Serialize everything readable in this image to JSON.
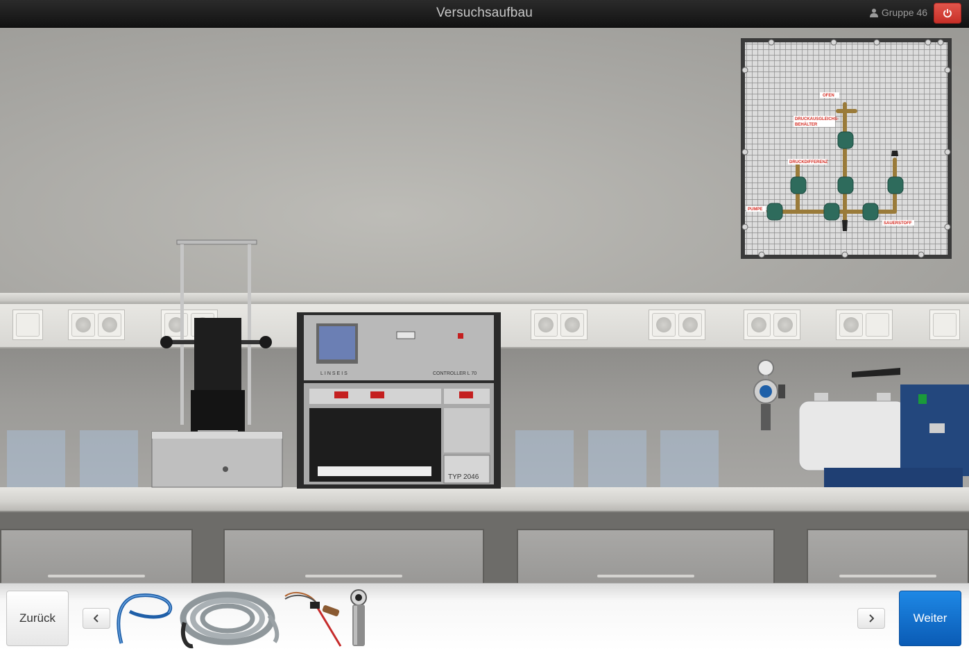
{
  "header": {
    "title": "Versuchsaufbau",
    "user_label": "Gruppe 46",
    "user_icon": "user-icon",
    "power_icon": "power-icon",
    "power_color": "#d9433a"
  },
  "panel": {
    "labels": {
      "ofen": "OFEN",
      "druckausgleich_1": "DRUCKAUSGLEICHS-",
      "druckausgleich_2": "BEHÄLTER",
      "druckdifferenz": "DRUCKDIFFERENZ",
      "pumpe": "PUMPE",
      "sauerstoff": "SAUERSTOFF"
    }
  },
  "devices": {
    "controller_name": "CONTROLLER L 70",
    "recorder_type": "TYP 2046",
    "brand": "LINSEIS"
  },
  "toolbar": {
    "back_label": "Zurück",
    "next_label": "Weiter",
    "next_color": "#0d6fd1",
    "prev_icon": "chevron-left-icon",
    "next_icon": "chevron-right-icon",
    "items": [
      "blue-tube",
      "grey-hose",
      "thermocouple-cable",
      "steel-cylinder"
    ]
  }
}
